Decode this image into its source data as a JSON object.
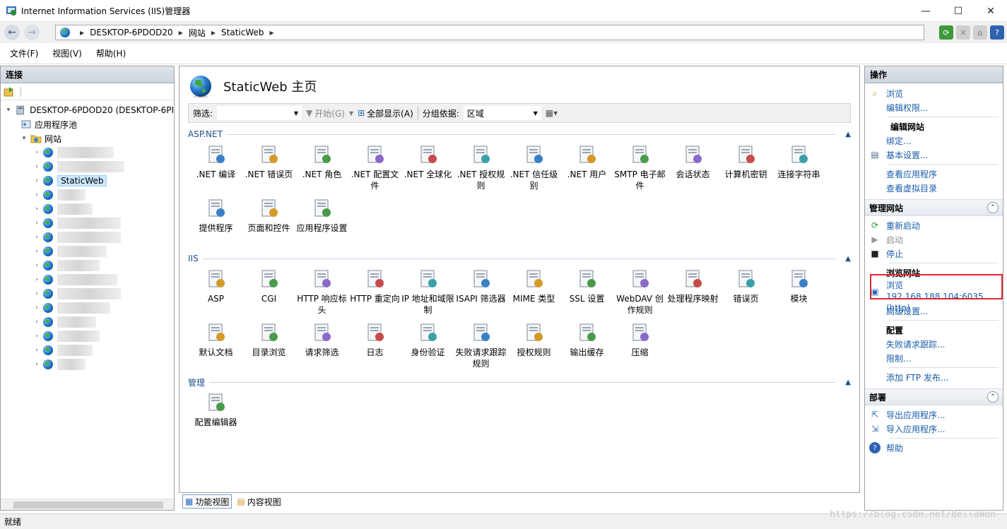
{
  "window": {
    "title": "Internet Information Services (IIS)管理器"
  },
  "address": {
    "segments": [
      "DESKTOP-6PDOD20",
      "网站",
      "StaticWeb"
    ]
  },
  "menu": {
    "file": "文件(F)",
    "view": "视图(V)",
    "help": "帮助(H)"
  },
  "left": {
    "header": "连接",
    "server": "DESKTOP-6PDOD20 (DESKTOP-6PI",
    "app_pools": "应用程序池",
    "sites": "网站",
    "selected_site": "StaticWeb"
  },
  "center": {
    "title": "StaticWeb 主页",
    "filter_label": "筛选:",
    "start_label": "开始(G)",
    "show_all_label": "全部显示(A)",
    "group_by_label": "分组依据:",
    "group_by_value": "区域",
    "groups": [
      {
        "name": "ASP.NET",
        "items": [
          ".NET 编译",
          ".NET 错误页",
          ".NET 角色",
          ".NET 配置文件",
          ".NET 全球化",
          ".NET 授权规则",
          ".NET 信任级别",
          ".NET 用户",
          "SMTP 电子邮件",
          "会话状态",
          "计算机密钥",
          "连接字符串",
          "提供程序",
          "页面和控件",
          "应用程序设置"
        ]
      },
      {
        "name": "IIS",
        "items": [
          "ASP",
          "CGI",
          "HTTP 响应标头",
          "HTTP 重定向",
          "IP 地址和域限制",
          "ISAPI 筛选器",
          "MIME 类型",
          "SSL 设置",
          "WebDAV 创作规则",
          "处理程序映射",
          "错误页",
          "模块",
          "默认文档",
          "目录浏览",
          "请求筛选",
          "日志",
          "身份验证",
          "失败请求跟踪规则",
          "授权规则",
          "输出缓存",
          "压缩"
        ]
      },
      {
        "name": "管理",
        "items": [
          "配置编辑器"
        ]
      }
    ],
    "tab_feature": "功能视图",
    "tab_content": "内容视图"
  },
  "right": {
    "header": "操作",
    "browse": "浏览",
    "edit_perms": "编辑权限...",
    "edit_site": "编辑网站",
    "bindings": "绑定...",
    "basic": "基本设置...",
    "view_apps": "查看应用程序",
    "view_vdirs": "查看虚拟目录",
    "manage_site": "管理网站",
    "restart": "重新启动",
    "start": "启动",
    "stop": "停止",
    "browse_site": "浏览网站",
    "browse_url": "浏览 192.168.188.104:6035",
    "browse_url2": "(http)",
    "advanced": "高级设置...",
    "config": "配置",
    "failed_trace": "失败请求跟踪...",
    "limits": "限制...",
    "add_ftp": "添加 FTP 发布...",
    "deploy": "部署",
    "export_app": "导出应用程序...",
    "import_app": "导入应用程序...",
    "help": "帮助"
  },
  "status": {
    "text": "就绪"
  },
  "watermark": "https://blog.csdn.net/BellaWon"
}
